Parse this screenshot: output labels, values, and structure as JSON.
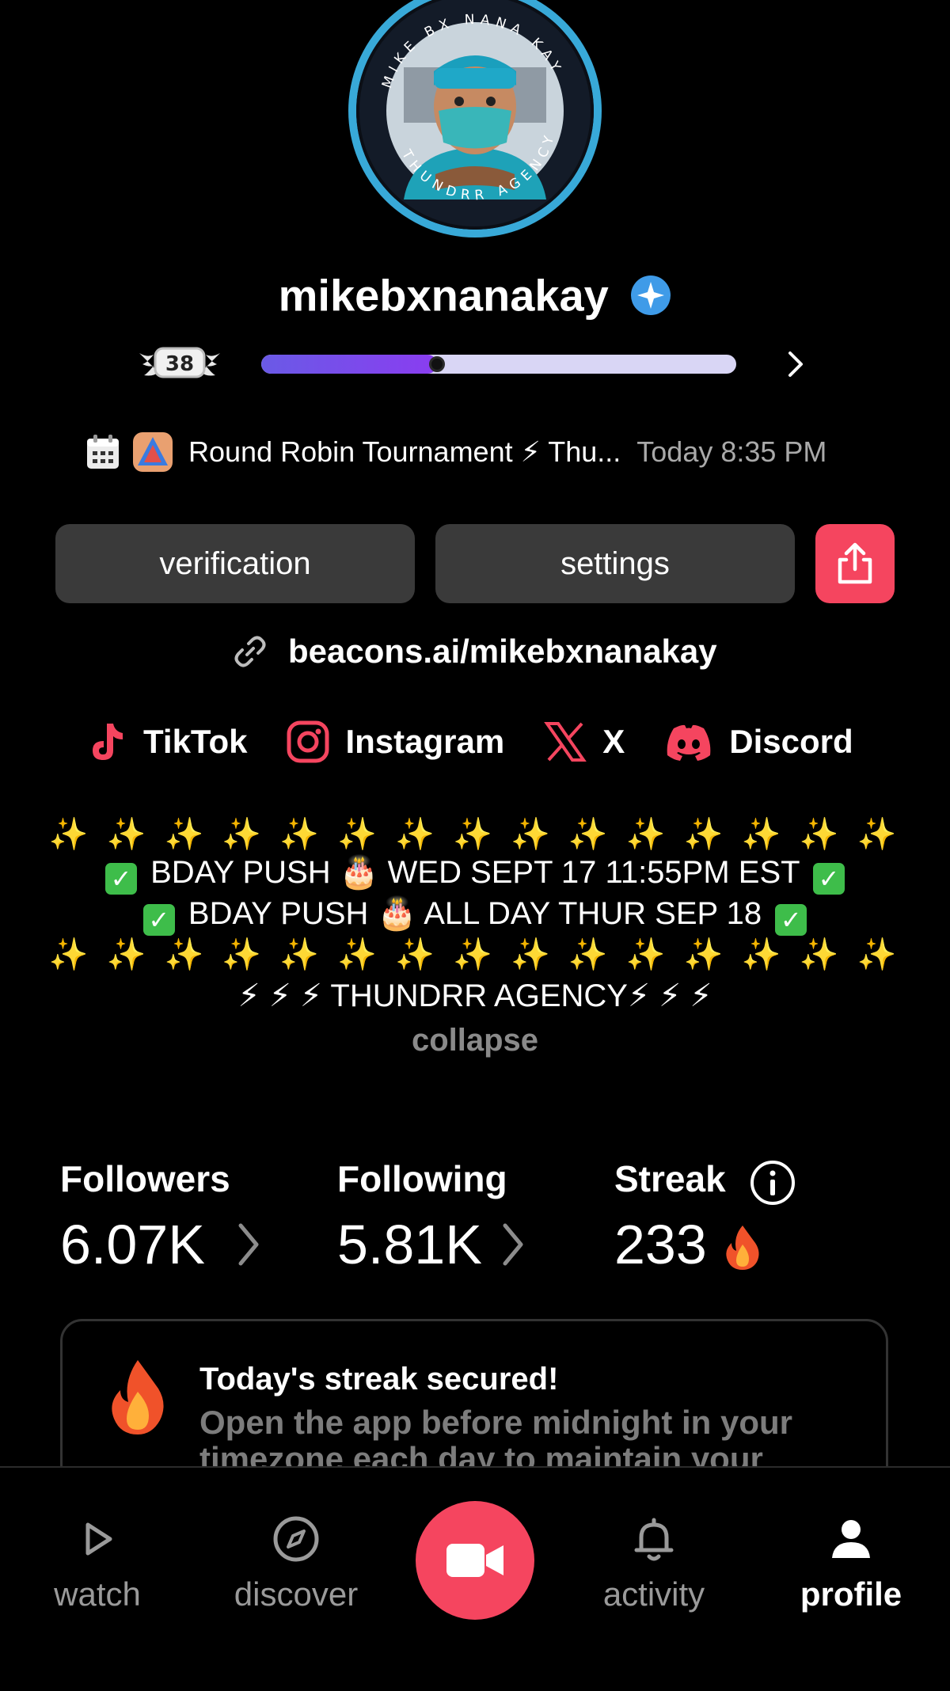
{
  "profile": {
    "username": "mikebxnanakay",
    "avatar_ring_text_top": "MIKE BX NANA KAY",
    "avatar_ring_text_bottom": "THUNDRR AGENCY",
    "level": "38",
    "level_progress_fraction": 0.37
  },
  "event": {
    "title": "Round Robin Tournament ⚡ Thu...",
    "time": "Today 8:35 PM"
  },
  "buttons": {
    "verification": "verification",
    "settings": "settings"
  },
  "link": "beacons.ai/mikebxnanakay",
  "socials": [
    {
      "label": "TikTok",
      "icon": "tiktok-icon"
    },
    {
      "label": "Instagram",
      "icon": "instagram-icon"
    },
    {
      "label": "X",
      "icon": "x-icon"
    },
    {
      "label": "Discord",
      "icon": "discord-icon"
    }
  ],
  "bio": {
    "sparkles": "✨ ✨ ✨ ✨ ✨ ✨ ✨ ✨ ✨ ✨ ✨ ✨ ✨ ✨ ✨",
    "line1": "BDAY PUSH 🎂 WED SEPT 17 11:55PM EST",
    "line2": "BDAY PUSH 🎂 ALL DAY THUR SEP 18",
    "agency": "⚡ ⚡ ⚡ THUNDRR AGENCY⚡ ⚡ ⚡",
    "collapse": "collapse"
  },
  "stats": {
    "followers_label": "Followers",
    "followers_value": "6.07K",
    "following_label": "Following",
    "following_value": "5.81K",
    "streak_label": "Streak",
    "streak_value": "233"
  },
  "streak_card": {
    "title": "Today's streak secured!",
    "description": "Open the app before midnight in your timezone each day to maintain your"
  },
  "nav": {
    "watch": "watch",
    "discover": "discover",
    "activity": "activity",
    "profile": "profile"
  },
  "colors": {
    "accent": "#f5455f",
    "progress": "#7b4ff0",
    "verified": "#3f9be8"
  }
}
